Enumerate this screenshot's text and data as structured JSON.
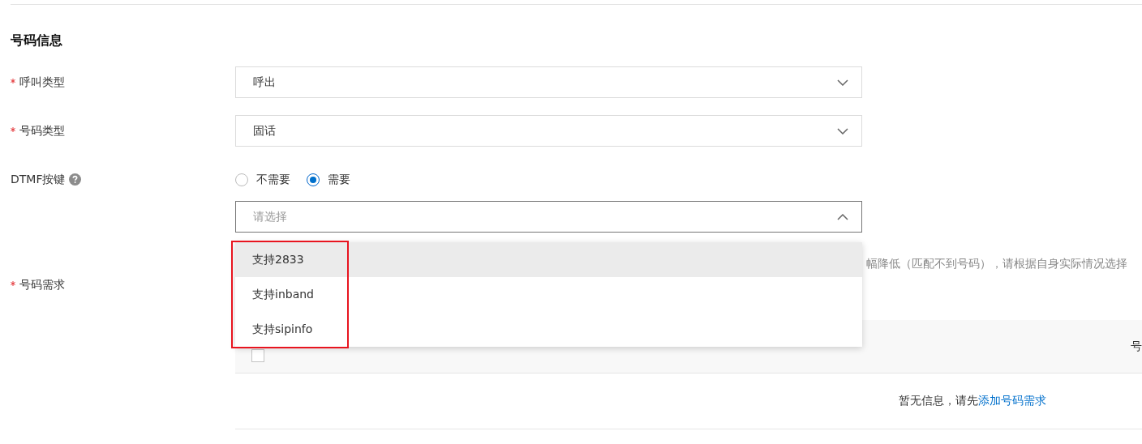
{
  "section_title": "号码信息",
  "fields": [
    {
      "kind": "select",
      "label": "呼叫类型",
      "required": true,
      "value": "呼出"
    },
    {
      "kind": "select",
      "label": "号码类型",
      "required": true,
      "value": "固话"
    },
    {
      "kind": "radio",
      "label": "DTMF按键",
      "required": false,
      "help": true,
      "options": [
        {
          "label": "不需要",
          "selected": false
        },
        {
          "label": "需要",
          "selected": true
        }
      ]
    }
  ],
  "dtmf_select": {
    "placeholder": "请选择",
    "expanded": true,
    "options": [
      {
        "label": "支持2833",
        "highlighted": true
      },
      {
        "label": "支持inband",
        "highlighted": false
      },
      {
        "label": "支持sipinfo",
        "highlighted": false
      }
    ]
  },
  "hint": "幅降低（匹配不到号码），请根据自身实际情况选择",
  "requirement": {
    "label": "号码需求",
    "required": true,
    "columns": [
      "号"
    ],
    "select_all_checked": false,
    "empty_text": "暂无信息，请先",
    "empty_link": "添加号码需求"
  }
}
